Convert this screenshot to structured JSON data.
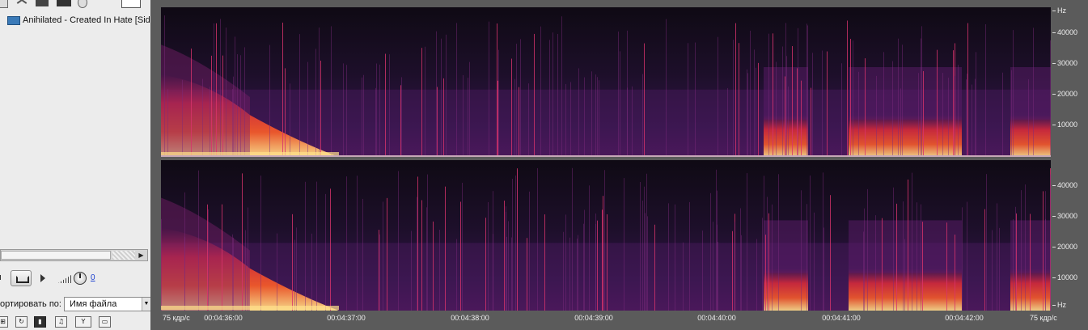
{
  "left_panel": {
    "file_item": {
      "name": "Anihilated - Created In Hate [Side"
    },
    "volume_value": "0",
    "sort": {
      "label": "ортировать по:",
      "selected": "Имя файла"
    },
    "bottom_icons": [
      "refresh-icon",
      "loop-icon",
      "stop-icon",
      "music-note-icon",
      "filter-eye-icon",
      "tag-icon"
    ]
  },
  "spectrogram": {
    "channels": [
      "top",
      "bottom"
    ],
    "freq_unit": "Hz",
    "freq_ticks": [
      "40000",
      "30000",
      "20000",
      "10000"
    ],
    "bottom_unit": "Hz",
    "frame_rate_left": "75 кдр/с",
    "frame_rate_right": "75 кдр/с",
    "time_ticks": [
      "00:04:36:00",
      "00:04:37:00",
      "00:04:38:00",
      "00:04:39:00",
      "00:04:40:00",
      "00:04:41:00",
      "00:04:42:00"
    ],
    "colors": {
      "background": "#120c18",
      "low": "#3a1450",
      "mid": "#d42a3a",
      "high": "#ffe08a"
    }
  }
}
